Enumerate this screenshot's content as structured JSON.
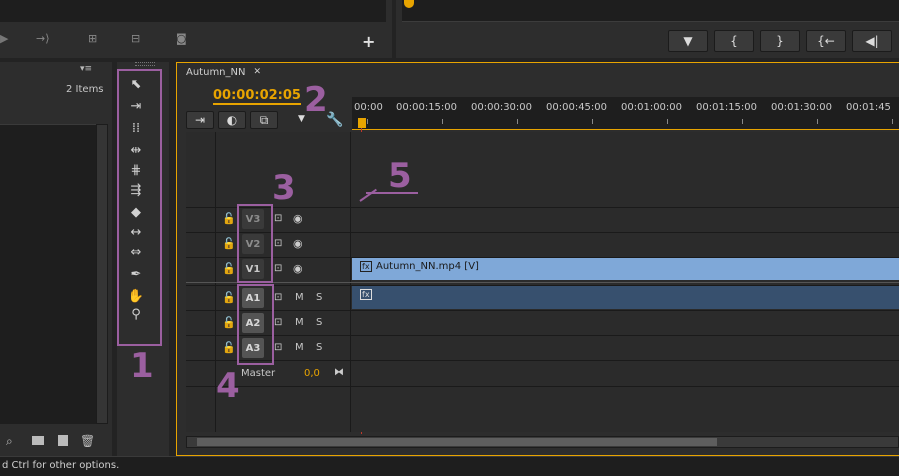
{
  "project_panel": {
    "items_count": "2 Items"
  },
  "sequence": {
    "tab_name": "Autumn_NN",
    "timecode": "00:00:02:05",
    "ruler_ticks": [
      "00:00",
      "00:00:15:00",
      "00:00:30:00",
      "00:00:45:00",
      "00:01:00:00",
      "00:01:15:00",
      "00:01:30:00",
      "00:01:45"
    ]
  },
  "tracks": {
    "video": [
      "V3",
      "V2",
      "V1"
    ],
    "audio": [
      "A1",
      "A2",
      "A3"
    ],
    "mute": "M",
    "solo": "S",
    "master_label": "Master",
    "master_value": "0,0"
  },
  "clips": {
    "video_clip": "Autumn_NN.mp4 [V]",
    "fx_badge": "fx"
  },
  "status_bar": {
    "text": "d Ctrl for other options."
  },
  "annotations": {
    "n1": "1",
    "n2": "2",
    "n3": "3",
    "n4": "4",
    "n5": "5"
  },
  "icons": {
    "marker_buttons": [
      "marker-icon",
      "mark-in-icon",
      "mark-out-icon",
      "go-to-in-icon",
      "step-back-icon"
    ],
    "tools": [
      "selection-tool-icon",
      "track-select-tool-icon",
      "ripple-edit-tool-icon",
      "rolling-edit-tool-icon",
      "rate-stretch-tool-icon",
      "razor-tool-icon",
      "slip-tool-icon",
      "slide-tool-icon",
      "pen-tool-icon",
      "hand-tool-icon",
      "zoom-tool-icon"
    ]
  },
  "colors": {
    "timecode": "#e8a400",
    "annotation": "#9b5fa0",
    "video_clip": "#7fa8d8",
    "audio_clip": "#37506e",
    "playhead": "#c0392b"
  }
}
